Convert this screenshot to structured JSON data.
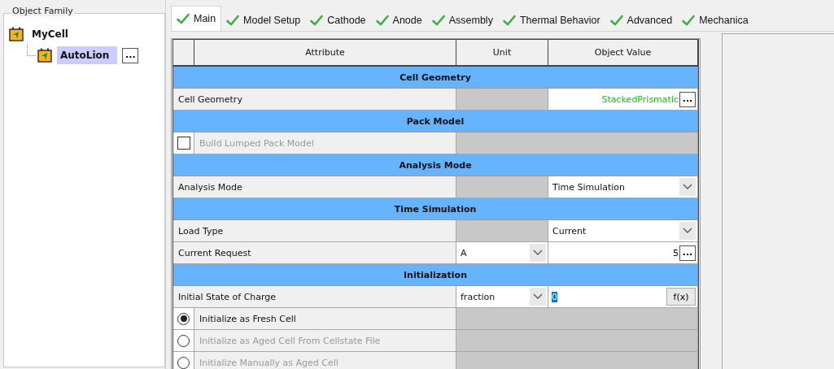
{
  "tree": {
    "title": "Object Family",
    "items": [
      {
        "label": "MyCell",
        "selected": false,
        "children": [
          {
            "label": "AutoLion",
            "selected": true,
            "button": "..."
          }
        ]
      }
    ]
  },
  "tabs": [
    {
      "label": "Main",
      "selected": true
    },
    {
      "label": "Model Setup",
      "selected": false
    },
    {
      "label": "Cathode",
      "selected": false
    },
    {
      "label": "Anode",
      "selected": false
    },
    {
      "label": "Assembly",
      "selected": false
    },
    {
      "label": "Thermal Behavior",
      "selected": false
    },
    {
      "label": "Advanced",
      "selected": false
    },
    {
      "label": "Mechanica",
      "selected": false
    }
  ],
  "table": {
    "columns": [
      "Attribute",
      "Unit",
      "Object Value"
    ],
    "rows": [
      {
        "kind": "section",
        "title": "Cell Geometry"
      },
      {
        "kind": "field",
        "label": "Cell Geometry",
        "value": {
          "kind": "browse",
          "text": "StackedPrismatic",
          "color": "#22bb22",
          "button": "..."
        }
      },
      {
        "kind": "section",
        "title": "Pack Model"
      },
      {
        "kind": "checkbox",
        "label": "Build Lumped Pack Model",
        "checked": false,
        "disabled": true
      },
      {
        "kind": "section",
        "title": "Analysis Mode"
      },
      {
        "kind": "field",
        "label": "Analysis Mode",
        "value": {
          "kind": "select",
          "text": "Time Simulation"
        }
      },
      {
        "kind": "section",
        "title": "Time Simulation"
      },
      {
        "kind": "field",
        "label": "Load Type",
        "value": {
          "kind": "select",
          "text": "Current"
        }
      },
      {
        "kind": "field",
        "label": "Current Request",
        "unit": "A",
        "value": {
          "kind": "browse",
          "text": "5",
          "color": "#000000",
          "button": "..."
        }
      },
      {
        "kind": "section",
        "title": "Initialization"
      },
      {
        "kind": "field",
        "label": "Initial State of Charge",
        "unit": "fraction",
        "value": {
          "kind": "formula",
          "text": "0",
          "text_selected": true,
          "button": "f(x)"
        }
      },
      {
        "kind": "radio",
        "label": "Initialize as Fresh Cell",
        "selected": true,
        "disabled": false
      },
      {
        "kind": "radio",
        "label": "Initialize as Aged Cell From Cellstate File",
        "selected": false,
        "disabled": true
      },
      {
        "kind": "radio",
        "label": "Initialize Manually as Aged Cell",
        "selected": false,
        "disabled": true
      }
    ]
  }
}
